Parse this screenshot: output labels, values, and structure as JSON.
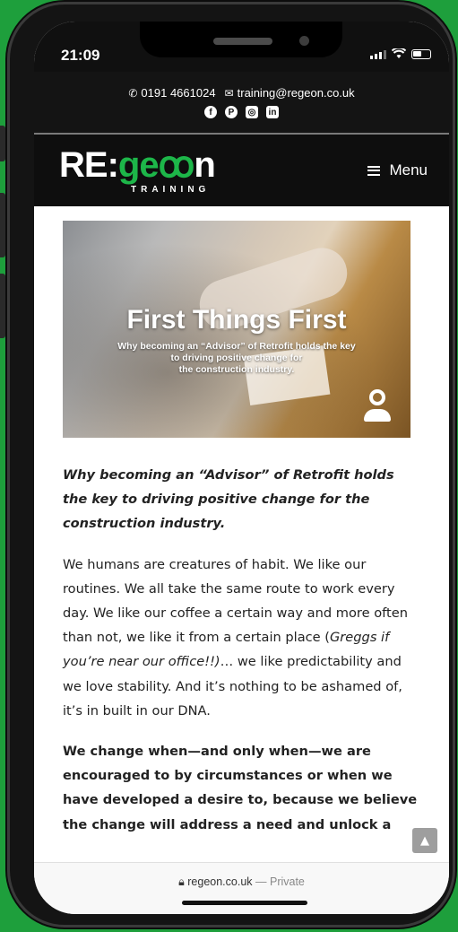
{
  "status_bar": {
    "time": "21:09"
  },
  "topbar": {
    "phone_icon": "phone-icon",
    "phone": "0191 4661024",
    "email_icon": "mail-icon",
    "email": "training@regeon.co.uk",
    "social": [
      {
        "name": "facebook-icon",
        "glyph": "f"
      },
      {
        "name": "pinterest-icon",
        "glyph": "P"
      },
      {
        "name": "instagram-icon",
        "glyph": "◎"
      },
      {
        "name": "linkedin-icon",
        "glyph": "in"
      }
    ]
  },
  "header": {
    "logo_left": "RE:",
    "logo_right": "ge",
    "logo_end": "n",
    "logo_sub": "TRAINING",
    "menu_label": "Menu"
  },
  "hero": {
    "title": "First Things First",
    "subtitle_1": "Why becoming an “Advisor” of Retrofit holds the key",
    "subtitle_2": "to driving positive change for",
    "subtitle_3": "the construction industry."
  },
  "article": {
    "intro": "Why becoming an “Advisor” of Retrofit holds the key to driving positive change for the construction industry.",
    "para1_a": "We humans are creatures of habit. We like our routines. We all take the same route to work every day. We like our coffee a certain way and more often than not, we like it from a certain place (",
    "para1_em": "Greggs if you’re near our office!!)",
    "para1_b": "… we like predictability and we love stability. And it’s nothing to be ashamed of, it’s in built in our DNA.",
    "para2": "We change when—and only when—we are encouraged to by circumstances or when we have developed a desire to, because we believe the change will address a need and unlock a"
  },
  "browser": {
    "lock_icon": "lock-icon",
    "url": "regeon.co.uk",
    "separator": " — ",
    "private": "Private",
    "scroll_top_glyph": "▲"
  },
  "colors": {
    "brand_green": "#1db649",
    "background_green": "#1e9f3c"
  }
}
